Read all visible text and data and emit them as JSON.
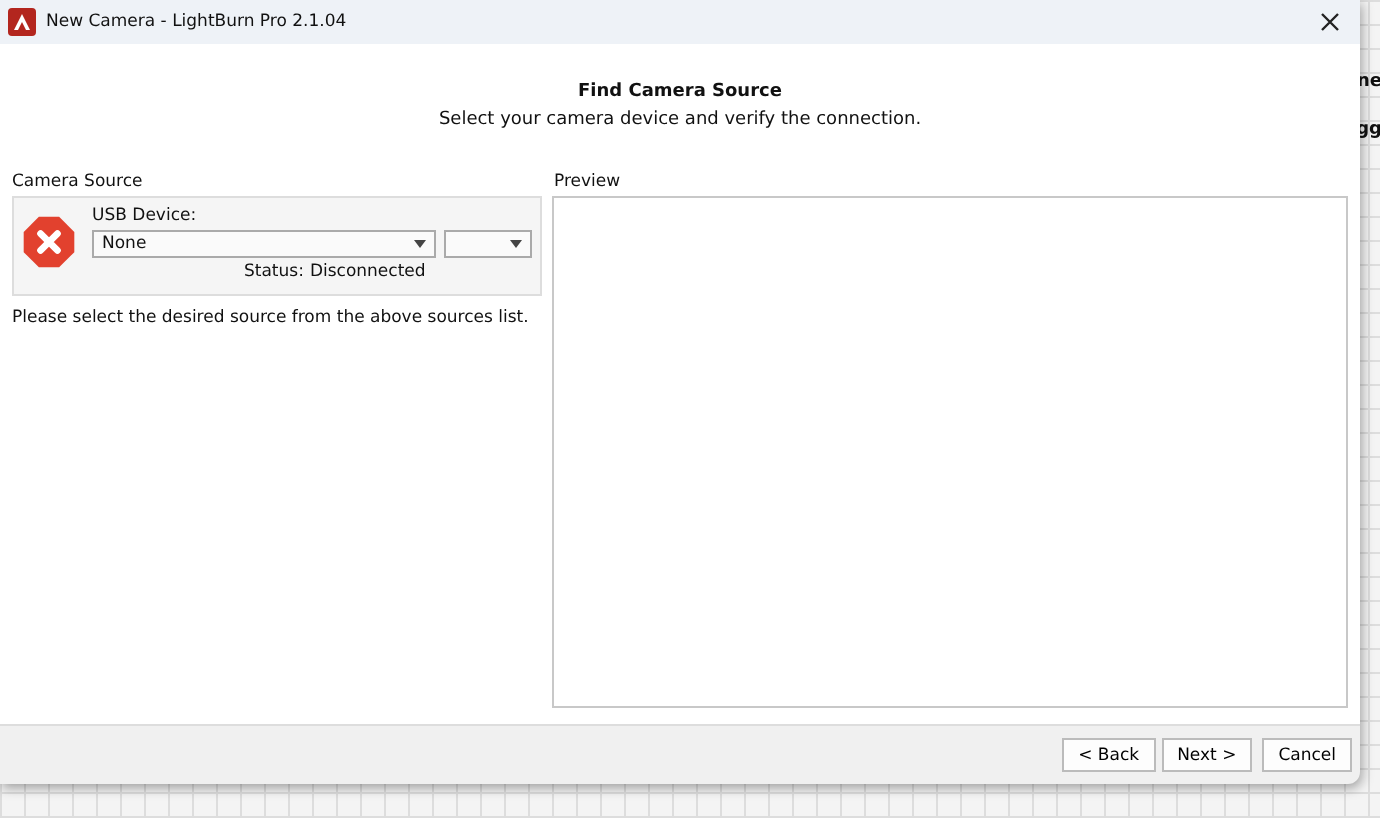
{
  "background": {
    "fragments": [
      "ne",
      "gg"
    ]
  },
  "window": {
    "title": "New Camera - LightBurn Pro 2.1.04"
  },
  "header": {
    "title": "Find Camera Source",
    "subtitle": "Select your camera device and verify the connection."
  },
  "camera_source": {
    "label": "Camera Source",
    "device_label": "USB Device:",
    "device_value": "None",
    "status_label": "Status:",
    "status_value": "Disconnected",
    "connected": false
  },
  "hint": "Please select the desired source from the above sources list.",
  "preview": {
    "label": "Preview"
  },
  "buttons": [
    "< Back",
    "Next >",
    "Cancel"
  ]
}
